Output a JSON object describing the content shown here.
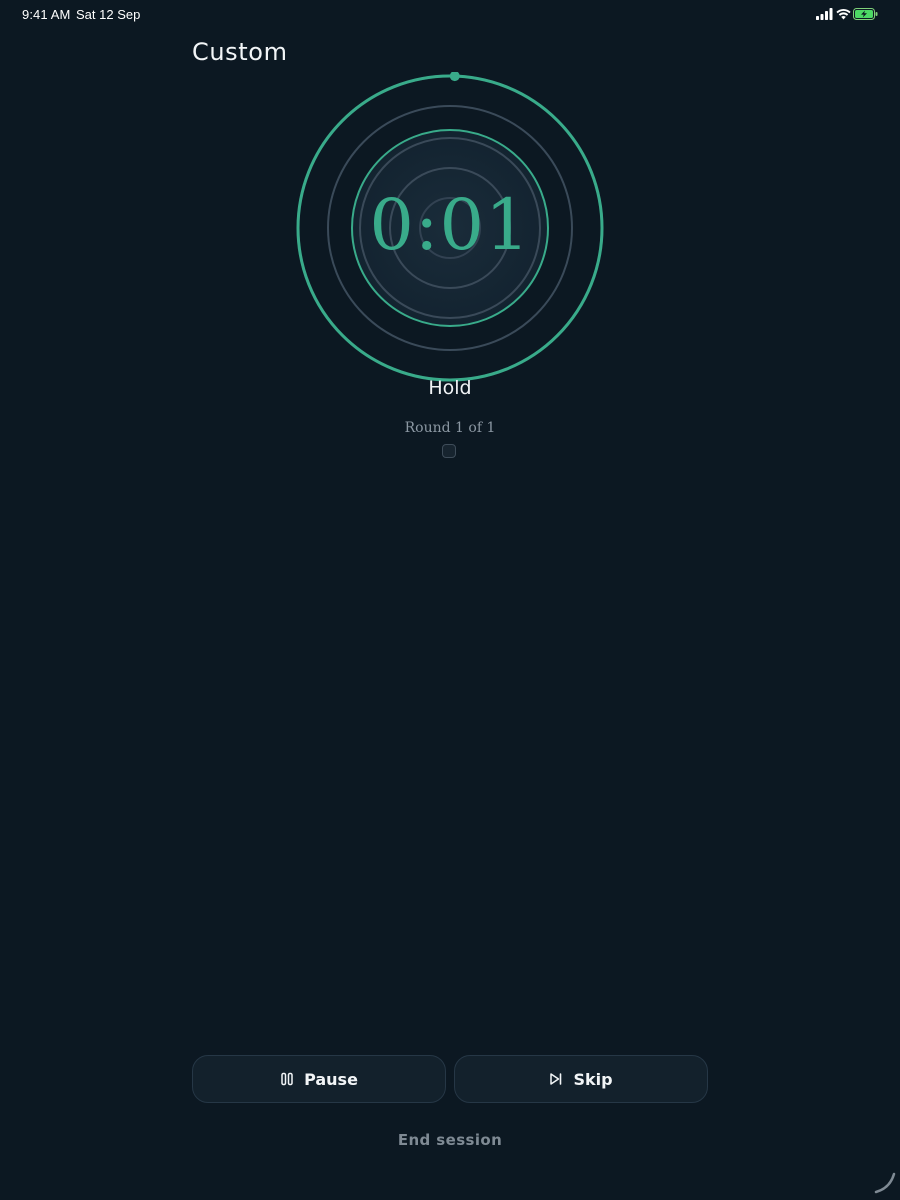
{
  "status_bar": {
    "time": "9:41 AM",
    "date": "Sat 12 Sep",
    "icons": [
      "cellular-signal-icon",
      "wifi-icon",
      "battery-charging-icon"
    ]
  },
  "session": {
    "title": "Custom",
    "timer": "0:01",
    "phase": "Hold",
    "round": "Round 1 of 1",
    "progress": 0.005
  },
  "controls": {
    "pause_label": "Pause",
    "pause_icon": "pause-icon",
    "skip_label": "Skip",
    "skip_icon": "skip-forward-icon",
    "end_label": "End session"
  },
  "colors": {
    "background": "#0c1822",
    "accent": "#39ab8a",
    "ring_muted": "#3a4a59",
    "button_bg": "#13212c"
  }
}
